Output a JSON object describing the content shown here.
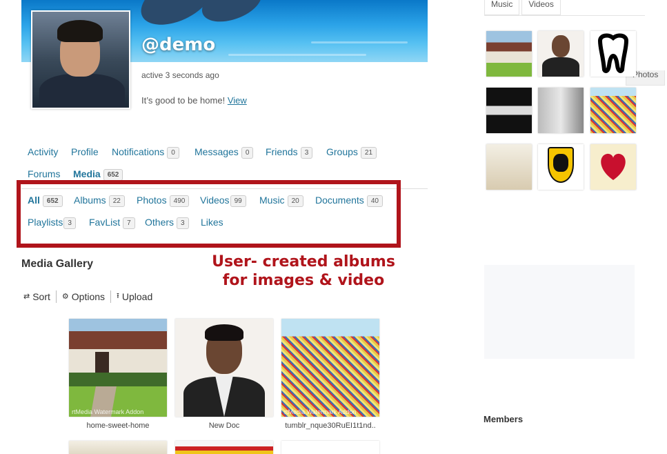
{
  "profile": {
    "handle": "@demo",
    "active": "active 3 seconds ago",
    "status_text": "It’s good to be home!",
    "status_link": "View"
  },
  "nav": [
    {
      "label": "Activity"
    },
    {
      "label": "Profile"
    },
    {
      "label": "Notifications",
      "count": "0"
    },
    {
      "label": "Messages",
      "count": "0"
    },
    {
      "label": "Friends",
      "count": "3"
    },
    {
      "label": "Groups",
      "count": "21"
    },
    {
      "label": "Forums"
    },
    {
      "label": "Media",
      "count": "652",
      "current": true
    }
  ],
  "media_tabs": [
    {
      "label": "All",
      "count": "652",
      "current": true
    },
    {
      "label": "Albums",
      "count": "22"
    },
    {
      "label": "Photos",
      "count": "490"
    },
    {
      "label": "Videos",
      "count": "99"
    },
    {
      "label": "Music",
      "count": "20"
    },
    {
      "label": "Documents",
      "count": "40"
    },
    {
      "label": "Playlists",
      "count": "3"
    },
    {
      "label": "FavList",
      "count": "7"
    },
    {
      "label": "Others",
      "count": "3"
    },
    {
      "label": "Likes"
    }
  ],
  "annotation": {
    "line1": "User- created albums",
    "line2": "for images & video",
    "color": "#b0141b"
  },
  "gallery": {
    "title": "Media Gallery",
    "toolbar": {
      "sort": "Sort",
      "options": "Options",
      "upload": "Upload"
    },
    "items": [
      {
        "caption": "home-sweet-home",
        "watermark": "rtMedia Watermark Addon"
      },
      {
        "caption": "New Doc"
      },
      {
        "caption": "tumblr_nque30RuEI1t1nd..",
        "watermark": "rtMedia Watermark Addon"
      }
    ]
  },
  "sidebar": {
    "tabs": [
      "Photos",
      "Music",
      "Videos"
    ],
    "active_tab": "Photos",
    "members_title": "Members"
  },
  "colors": {
    "link": "#21759b",
    "highlight": "#b0141b"
  }
}
